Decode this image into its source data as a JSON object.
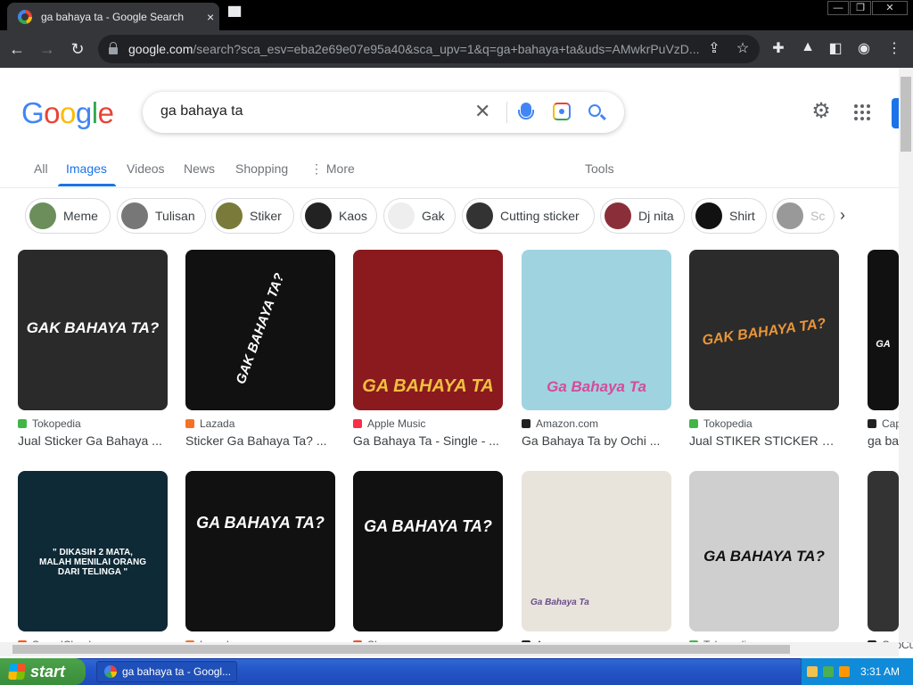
{
  "browser": {
    "tab_title": "ga bahaya ta - Google Search",
    "tab_close": "×",
    "new_tab": "▀",
    "url_host": "google.com",
    "url_rest": "/search?sca_esv=eba2e69e07e95a40&sca_upv=1&q=ga+bahaya+ta&uds=AMwkrPuVzD...",
    "win_min": "—",
    "win_max": "❐",
    "win_close": "✕"
  },
  "google": {
    "logo_letters": [
      "G",
      "o",
      "o",
      "g",
      "l",
      "e"
    ],
    "logo_colors": [
      "#4285f4",
      "#ea4335",
      "#fbbc05",
      "#4285f4",
      "#34a853",
      "#ea4335"
    ],
    "query": "ga bahaya ta",
    "clear": "✕",
    "gear": "⚙"
  },
  "nav_tabs": [
    "All",
    "Images",
    "Videos",
    "News",
    "Shopping",
    "⋮ More",
    "Tools"
  ],
  "chips": [
    {
      "label": "Meme",
      "color": "#6b8e5a"
    },
    {
      "label": "Tulisan",
      "color": "#777"
    },
    {
      "label": "Stiker",
      "color": "#7a7a3a"
    },
    {
      "label": "Kaos",
      "color": "#222"
    },
    {
      "label": "Gak",
      "color": "#eee"
    },
    {
      "label": "Cutting sticker",
      "color": "#333"
    },
    {
      "label": "Dj nita",
      "color": "#8a2f3a"
    },
    {
      "label": "Shirt",
      "color": "#111"
    },
    {
      "label": "Sc",
      "color": "#999"
    }
  ],
  "chip_next": "›",
  "results_row1": [
    {
      "source": "Tokopedia",
      "title": "Jual Sticker Ga Bahaya ...",
      "img_text": "GAK BAHAYA TA?",
      "src_color": "#42b549",
      "bg": "#2a2a2a",
      "fg": "#fff"
    },
    {
      "source": "Lazada",
      "title": "Sticker Ga Bahaya Ta? ...",
      "img_text": "GAK BAHAYA TA?",
      "src_color": "#f57224",
      "bg": "#111",
      "fg": "#fff"
    },
    {
      "source": "Apple Music",
      "title": "Ga Bahaya Ta - Single - ...",
      "img_text": "GA BAHAYA TA",
      "src_color": "#fa2d48",
      "bg": "#8b1a1f",
      "fg": "#f0c040"
    },
    {
      "source": "Amazon.com",
      "title": "Ga Bahaya Ta by Ochi ...",
      "img_text": "Ga Bahaya Ta",
      "src_color": "#222",
      "bg": "#9fd3e0",
      "fg": "#d64b9a"
    },
    {
      "source": "Tokopedia",
      "title": "Jual STIKER STICKER G...",
      "img_text": "GAK BAHAYA TA?",
      "src_color": "#42b549",
      "bg": "#2b2b2b",
      "fg": "#e8953a"
    },
    {
      "source": "CapCut",
      "title": "ga bah",
      "img_text": "GA",
      "src_color": "#222",
      "bg": "#111",
      "fg": "#fff"
    }
  ],
  "results_row2": [
    {
      "source": "SoundCloud",
      "title": "",
      "img_text": "\" DIKASIH 2 MATA, MALAH MENILAI ORANG DARI TELINGA \"",
      "src_color": "#ff5500",
      "bg": "#0e2a36",
      "fg": "#fff"
    },
    {
      "source": "Lazada",
      "title": "",
      "img_text": "GA BAHAYA TA?",
      "src_color": "#f57224",
      "bg": "#111",
      "fg": "#fff"
    },
    {
      "source": "Shopee",
      "title": "",
      "img_text": "GA BAHAYA TA?",
      "src_color": "#ee4d2d",
      "bg": "#111",
      "fg": "#fff"
    },
    {
      "source": "Amazon.com",
      "title": "",
      "img_text": "Ga Bahaya Ta",
      "src_color": "#222",
      "bg": "#e8e4dc",
      "fg": "#6a4c8c"
    },
    {
      "source": "Tokopedia",
      "title": "",
      "img_text": "GA BAHAYA TA?",
      "src_color": "#42b549",
      "bg": "#cfcfcf",
      "fg": "#111"
    },
    {
      "source": "CapCut",
      "title": "",
      "img_text": "",
      "src_color": "#222",
      "bg": "#333",
      "fg": "#fff"
    }
  ],
  "taskbar": {
    "start": "start",
    "item": "ga bahaya ta - Googl...",
    "clock": "3:31 AM"
  }
}
